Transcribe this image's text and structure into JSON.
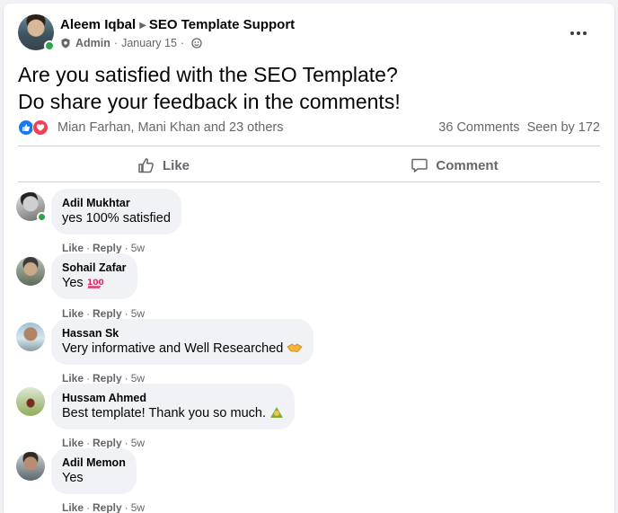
{
  "post": {
    "author": "Aleem Iqbal",
    "group": "SEO Template Support",
    "role": "Admin",
    "date": "January 15",
    "dot": "·",
    "text_line1": "Are you satisfied with the SEO Template?",
    "text_line2": "Do share your feedback in the comments!",
    "reactors": "Mian Farhan, Mani Khan and 23 others",
    "comments_count": "36 Comments",
    "seen_by": "Seen by 172"
  },
  "actions": {
    "like_label": "Like",
    "comment_label": "Comment"
  },
  "comment_actions": {
    "like": "Like",
    "reply": "Reply",
    "dot": "·"
  },
  "comments": [
    {
      "author": "Adil Mukhtar",
      "text": "yes 100% satisfied",
      "time": "5w",
      "emoji": ""
    },
    {
      "author": "Sohail Zafar",
      "text": "Yes",
      "time": "5w",
      "emoji": "hundred-points-emoji"
    },
    {
      "author": "Hassan Sk",
      "text": "Very informative and Well Researched",
      "time": "5w",
      "emoji": "handshake-emoji"
    },
    {
      "author": "Hussam Ahmed",
      "text": "Best template! Thank you so much.",
      "time": "5w",
      "emoji": "hugging-emoji"
    },
    {
      "author": "Adil Memon",
      "text": "Yes",
      "time": "5w",
      "emoji": ""
    }
  ],
  "colors": {
    "accent": "#1877f2",
    "love": "#f33e58",
    "online": "#31a24c",
    "muted": "#65676b",
    "bubble": "#f0f2f5"
  }
}
